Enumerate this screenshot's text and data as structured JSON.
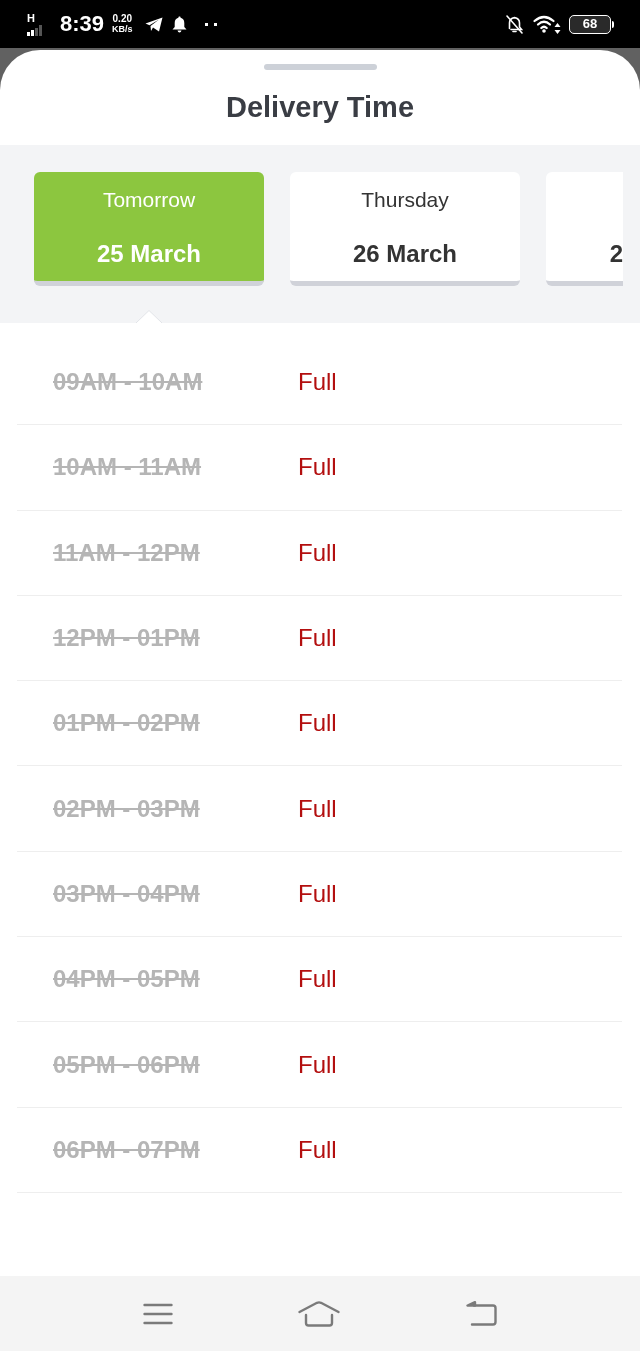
{
  "status_bar": {
    "network": "H",
    "time": "8:39",
    "speed_value": "0.20",
    "speed_unit": "KB/s",
    "battery": "68"
  },
  "sheet": {
    "title": "Delivery Time"
  },
  "dates": [
    {
      "day": "Tomorrow",
      "date": "25 March",
      "selected": true
    },
    {
      "day": "Thursday",
      "date": "26 March",
      "selected": false
    },
    {
      "date": "2",
      "selected": false
    }
  ],
  "slots": [
    {
      "time": "09AM - 10AM",
      "status": "Full",
      "disabled": true
    },
    {
      "time": "10AM - 11AM",
      "status": "Full",
      "disabled": true
    },
    {
      "time": "11AM - 12PM",
      "status": "Full",
      "disabled": true
    },
    {
      "time": "12PM - 01PM",
      "status": "Full",
      "disabled": true
    },
    {
      "time": "01PM - 02PM",
      "status": "Full",
      "disabled": true
    },
    {
      "time": "02PM - 03PM",
      "status": "Full",
      "disabled": true
    },
    {
      "time": "03PM - 04PM",
      "status": "Full",
      "disabled": true
    },
    {
      "time": "04PM - 05PM",
      "status": "Full",
      "disabled": true
    },
    {
      "time": "05PM - 06PM",
      "status": "Full",
      "disabled": true
    },
    {
      "time": "06PM - 07PM",
      "status": "Full",
      "disabled": true
    }
  ]
}
